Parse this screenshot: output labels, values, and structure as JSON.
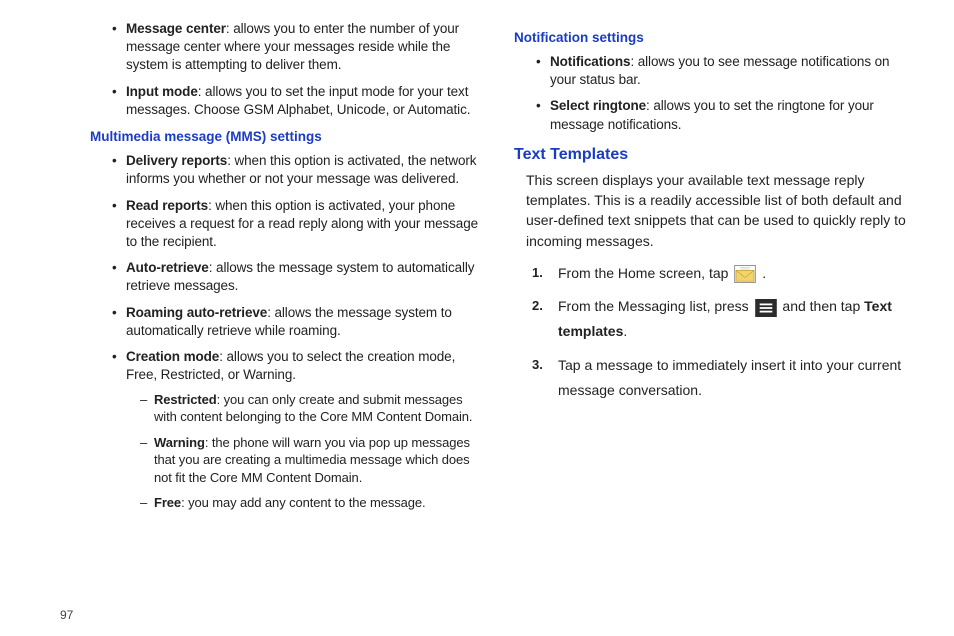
{
  "left": {
    "top_bullets": [
      {
        "term": "Message center",
        "desc": ": allows you to enter the number of your message center where your messages reside while the system is attempting to deliver them."
      },
      {
        "term": "Input mode",
        "desc": ": allows you to set the input mode for your text messages. Choose GSM Alphabet, Unicode, or Automatic."
      }
    ],
    "mms_heading": "Multimedia message (MMS) settings",
    "mms_bullets": [
      {
        "term": "Delivery reports",
        "desc": ": when this option is activated, the network informs you whether or not your message was delivered."
      },
      {
        "term": "Read reports",
        "desc": ": when this option is activated, your phone receives a request for a read reply along with your message to the recipient."
      },
      {
        "term": "Auto-retrieve",
        "desc": ": allows the message system to automatically retrieve messages."
      },
      {
        "term": "Roaming auto-retrieve",
        "desc": ": allows the message system to automatically retrieve while roaming."
      },
      {
        "term": "Creation mode",
        "desc": ": allows you to select the creation mode, Free, Restricted, or Warning."
      }
    ],
    "creation_sub": [
      {
        "term": "Restricted",
        "desc": ": you can only create and submit messages with content belonging to the Core MM Content Domain."
      },
      {
        "term": "Warning",
        "desc": ": the phone will warn you via pop up messages that you are creating a multimedia message which does not fit the Core MM Content Domain."
      },
      {
        "term": "Free",
        "desc": ": you may add any content to the message."
      }
    ]
  },
  "right": {
    "notif_heading": "Notification settings",
    "notif_bullets": [
      {
        "term": "Notifications",
        "desc": ": allows you to see message notifications on your status bar."
      },
      {
        "term": "Select ringtone",
        "desc": ": allows you to set the ringtone for your message notifications."
      }
    ],
    "tt_heading": "Text Templates",
    "tt_intro": "This screen displays your available text message reply templates. This is a readily accessible list of both default and user-defined text snippets that can be used to quickly reply to incoming messages.",
    "step1_pre": "From the Home screen, tap ",
    "step1_post": ".",
    "step2_pre": "From the Messaging list, press ",
    "step2_mid": " and then tap ",
    "step2_term": "Text templates",
    "step2_post": ".",
    "step3": "Tap a message to immediately insert it into your current message conversation."
  },
  "pagenum": "97"
}
